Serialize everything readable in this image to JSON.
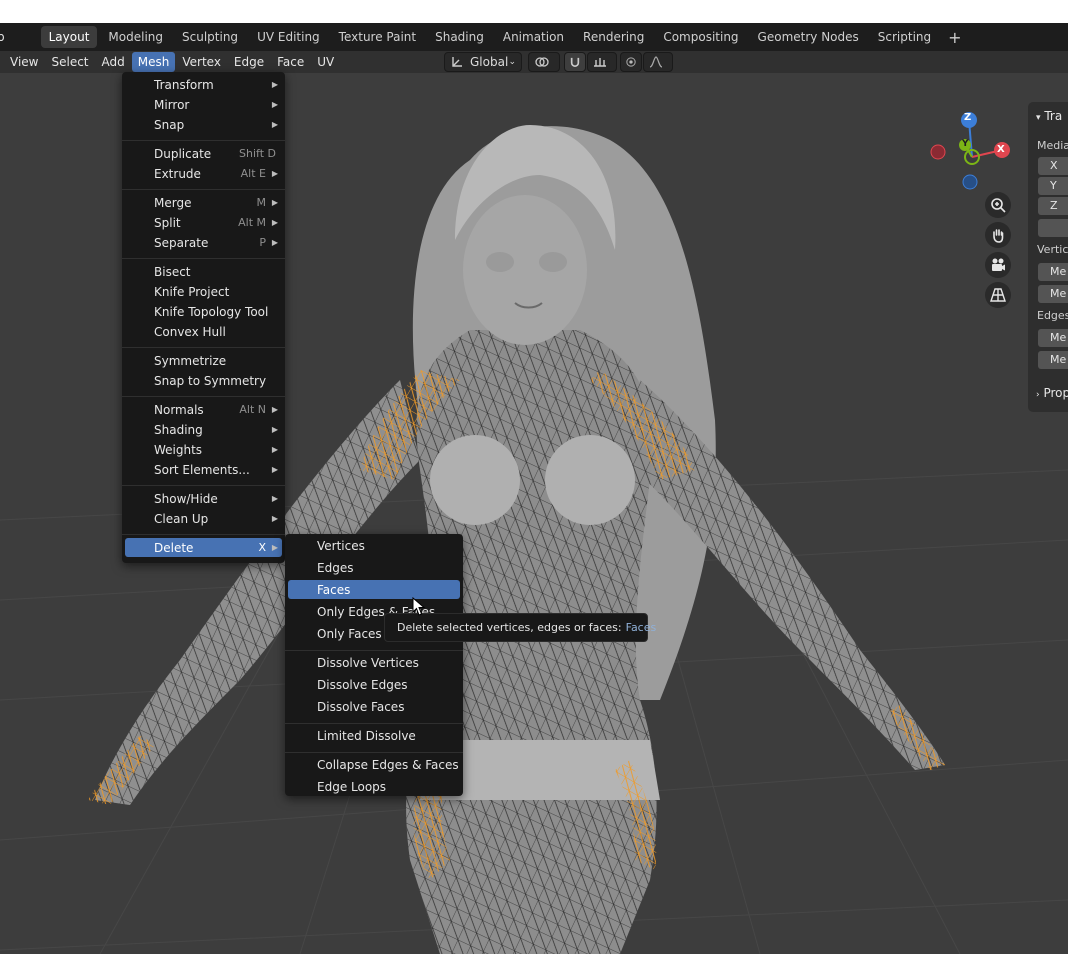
{
  "top_bar": {
    "app_letter": "p",
    "workspace_tabs": [
      "Layout",
      "Modeling",
      "Sculpting",
      "UV Editing",
      "Texture Paint",
      "Shading",
      "Animation",
      "Rendering",
      "Compositing",
      "Geometry Nodes",
      "Scripting"
    ],
    "active_tab": "Layout",
    "add_label": "+"
  },
  "header": {
    "menus": [
      "View",
      "Select",
      "Add",
      "Mesh",
      "Vertex",
      "Edge",
      "Face",
      "UV"
    ],
    "active_menu": "Mesh",
    "transform_orientation": "Global"
  },
  "gizmo": {
    "z": "Z",
    "y": "Y",
    "x": "X"
  },
  "npanel": {
    "header": "Tra",
    "median_label": "Media",
    "axes": [
      "X",
      "Y",
      "Z"
    ],
    "vertices_label": "Vertic",
    "edges_label": "Edges",
    "field_text": "Me",
    "properties_label": "Prop"
  },
  "mesh_menu": {
    "groups": [
      [
        {
          "label": "Transform",
          "shortcut": "",
          "submenu": true
        },
        {
          "label": "Mirror",
          "shortcut": "",
          "submenu": true
        },
        {
          "label": "Snap",
          "shortcut": "",
          "submenu": true
        }
      ],
      [
        {
          "label": "Duplicate",
          "shortcut": "Shift D",
          "submenu": false
        },
        {
          "label": "Extrude",
          "shortcut": "Alt E",
          "submenu": true
        }
      ],
      [
        {
          "label": "Merge",
          "shortcut": "M",
          "submenu": true
        },
        {
          "label": "Split",
          "shortcut": "Alt M",
          "submenu": true
        },
        {
          "label": "Separate",
          "shortcut": "P",
          "submenu": true
        }
      ],
      [
        {
          "label": "Bisect",
          "shortcut": "",
          "submenu": false
        },
        {
          "label": "Knife Project",
          "shortcut": "",
          "submenu": false
        },
        {
          "label": "Knife Topology Tool",
          "shortcut": "",
          "submenu": false
        },
        {
          "label": "Convex Hull",
          "shortcut": "",
          "submenu": false
        }
      ],
      [
        {
          "label": "Symmetrize",
          "shortcut": "",
          "submenu": false
        },
        {
          "label": "Snap to Symmetry",
          "shortcut": "",
          "submenu": false
        }
      ],
      [
        {
          "label": "Normals",
          "shortcut": "Alt N",
          "submenu": true
        },
        {
          "label": "Shading",
          "shortcut": "",
          "submenu": true
        },
        {
          "label": "Weights",
          "shortcut": "",
          "submenu": true
        },
        {
          "label": "Sort Elements...",
          "shortcut": "",
          "submenu": true
        }
      ],
      [
        {
          "label": "Show/Hide",
          "shortcut": "",
          "submenu": true
        },
        {
          "label": "Clean Up",
          "shortcut": "",
          "submenu": true
        }
      ],
      [
        {
          "label": "Delete",
          "shortcut": "X",
          "submenu": true,
          "highlighted": true
        }
      ]
    ]
  },
  "delete_menu": {
    "groups": [
      [
        {
          "label": "Vertices"
        },
        {
          "label": "Edges"
        },
        {
          "label": "Faces",
          "highlighted": true
        },
        {
          "label": "Only Edges & Faces"
        },
        {
          "label": "Only Faces"
        }
      ],
      [
        {
          "label": "Dissolve Vertices"
        },
        {
          "label": "Dissolve Edges"
        },
        {
          "label": "Dissolve Faces"
        }
      ],
      [
        {
          "label": "Limited Dissolve"
        }
      ],
      [
        {
          "label": "Collapse Edges & Faces"
        },
        {
          "label": "Edge Loops"
        }
      ]
    ]
  },
  "tooltip": {
    "text": "Delete selected vertices, edges or faces:",
    "value": "Faces"
  },
  "colors": {
    "accent": "#4772b3",
    "selection": "#f09a26",
    "axis_x": "#e0464f",
    "axis_y": "#7cb516",
    "axis_z": "#3c7ed8"
  }
}
